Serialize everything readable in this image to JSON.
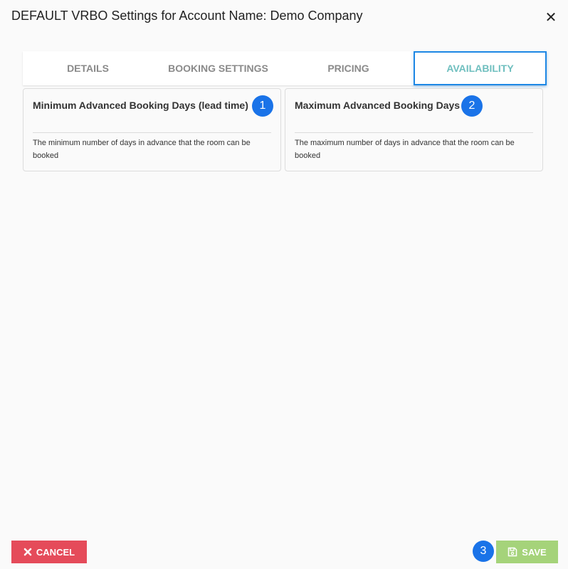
{
  "dialog": {
    "title": "DEFAULT VRBO Settings for Account Name: Demo Company",
    "close_icon": "close-icon"
  },
  "tabs": [
    {
      "label": "DETAILS",
      "active": false
    },
    {
      "label": "BOOKING SETTINGS",
      "active": false
    },
    {
      "label": "PRICING",
      "active": false
    },
    {
      "label": "AVAILABILITY",
      "active": true
    }
  ],
  "cards": [
    {
      "title": "Minimum Advanced Booking Days (lead time)",
      "description": "The minimum number of days in advance that the room can be booked",
      "badge": "1"
    },
    {
      "title": "Maximum Advanced Booking Days",
      "description": "The maximum number of days in advance that the room can be booked",
      "badge": "2"
    }
  ],
  "footer": {
    "cancel_label": "CANCEL",
    "cancel_icon": "x-icon",
    "save_label": "SAVE",
    "save_icon": "floppy-disk-icon",
    "save_badge": "3"
  },
  "colors": {
    "active_tab_text": "#6fbfbf",
    "active_tab_border": "#1e88e5",
    "badge": "#1a73e8",
    "cancel": "#e54b5a",
    "save": "#a5d37a"
  }
}
